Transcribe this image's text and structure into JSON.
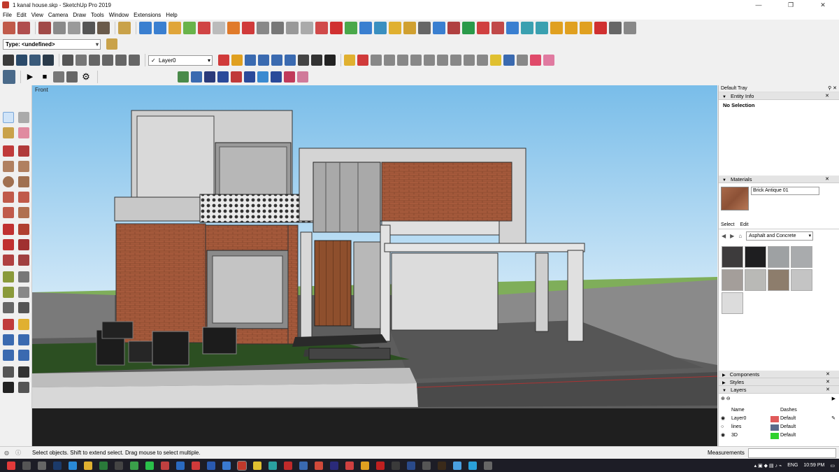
{
  "window": {
    "title": "1 kanal house.skp - SketchUp Pro 2019",
    "minimize": "—",
    "restore": "❐",
    "close": "✕"
  },
  "menu": [
    "File",
    "Edit",
    "View",
    "Camera",
    "Draw",
    "Tools",
    "Window",
    "Extensions",
    "Help"
  ],
  "toolbar": {
    "type_select": "Type: <undefined>",
    "layer_select": "Layer0"
  },
  "viewport": {
    "scene_label": "Front"
  },
  "tray": {
    "title": "Default Tray",
    "entity_info": {
      "header": "Entity Info",
      "selection": "No Selection"
    },
    "materials": {
      "header": "Materials",
      "current_material": "Brick Antique 01",
      "tab_select": "Select",
      "tab_edit": "Edit",
      "library": "Asphalt and Concrete",
      "swatch_colors": [
        "#3d3b3c",
        "#1e1e20",
        "#9ea1a3",
        "#a9abad",
        "#a49e9a",
        "#b9b9b6",
        "#8d7d6c",
        "#c4c4c4",
        "#dcdcdc"
      ]
    },
    "components": {
      "header": "Components"
    },
    "styles": {
      "header": "Styles"
    },
    "layers": {
      "header": "Layers",
      "col_name": "Name",
      "col_dashes": "Dashes",
      "rows": [
        {
          "name": "Layer0",
          "dashes": "Default",
          "color": "#e05a5a"
        },
        {
          "name": "lines",
          "dashes": "Default",
          "color": "#5a6a8a"
        },
        {
          "name": "3D",
          "dashes": "Default",
          "color": "#2ed12e"
        }
      ]
    }
  },
  "status": {
    "hint": "Select objects. Shift to extend select. Drag mouse to select multiple.",
    "measurements": "Measurements"
  },
  "taskbar": {
    "lang": "ENG",
    "time": "10:59 PM"
  }
}
